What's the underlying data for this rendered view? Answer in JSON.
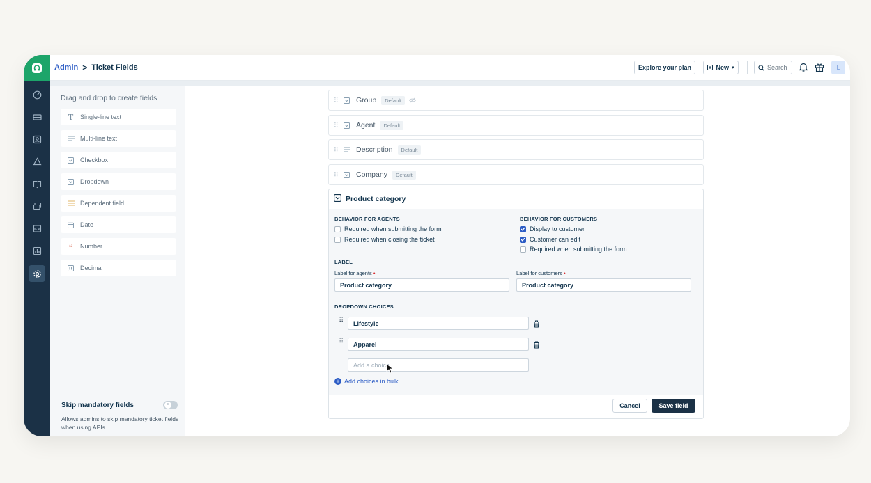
{
  "header": {
    "breadcrumb_root": "Admin",
    "breadcrumb_sep": ">",
    "breadcrumb_current": "Ticket Fields",
    "explore_label": "Explore your plan",
    "new_label": "New",
    "search_placeholder": "Search",
    "avatar_initial": "L"
  },
  "rail": {
    "icons": [
      "dashboard-icon",
      "tickets-icon",
      "contacts-icon",
      "groups-icon",
      "solutions-icon",
      "forums-icon",
      "reports-inbox-icon",
      "analytics-icon",
      "admin-gear-icon"
    ],
    "active": "admin-gear-icon",
    "brand_color": "#1da56a",
    "bg_color": "#1b3146"
  },
  "palette": {
    "title": "Drag and drop to create fields",
    "items": [
      {
        "label": "Single-line text",
        "icon": "text-icon"
      },
      {
        "label": "Multi-line text",
        "icon": "paragraph-icon"
      },
      {
        "label": "Checkbox",
        "icon": "checkbox-icon"
      },
      {
        "label": "Dropdown",
        "icon": "dropdown-icon"
      },
      {
        "label": "Dependent field",
        "icon": "dependent-icon"
      },
      {
        "label": "Date",
        "icon": "calendar-icon"
      },
      {
        "label": "Number",
        "icon": "number-icon"
      },
      {
        "label": "Decimal",
        "icon": "decimal-icon"
      }
    ],
    "skip_title": "Skip mandatory fields",
    "skip_desc": "Allows admins to skip mandatory ticket fields when using APIs."
  },
  "fields": [
    {
      "name": "Group",
      "badge": "Default",
      "icon": "dropdown-icon"
    },
    {
      "name": "Agent",
      "badge": "Default",
      "icon": "dropdown-icon"
    },
    {
      "name": "Description",
      "badge": "Default",
      "icon": "paragraph-icon"
    },
    {
      "name": "Company",
      "badge": "Default",
      "icon": "dropdown-icon"
    }
  ],
  "editor": {
    "title": "Product category",
    "agents_heading": "BEHAVIOR FOR AGENTS",
    "agents_options": [
      {
        "label": "Required when submitting the form",
        "checked": false
      },
      {
        "label": "Required when closing the ticket",
        "checked": false
      }
    ],
    "customers_heading": "BEHAVIOR FOR CUSTOMERS",
    "customers_options": [
      {
        "label": "Display to customer",
        "checked": true
      },
      {
        "label": "Customer can edit",
        "checked": true
      },
      {
        "label": "Required when submitting the form",
        "checked": false
      }
    ],
    "label_heading": "LABEL",
    "label_agents": "Label for agents",
    "label_customers": "Label for customers",
    "label_required_mark": "•",
    "label_agents_value": "Product category",
    "label_customers_value": "Product category",
    "choices_heading": "DROPDOWN CHOICES",
    "choices": [
      "Lifestyle",
      "Apparel"
    ],
    "add_choice_placeholder": "Add a choice",
    "bulk_label": "Add choices in bulk",
    "cancel_label": "Cancel",
    "save_label": "Save field"
  }
}
